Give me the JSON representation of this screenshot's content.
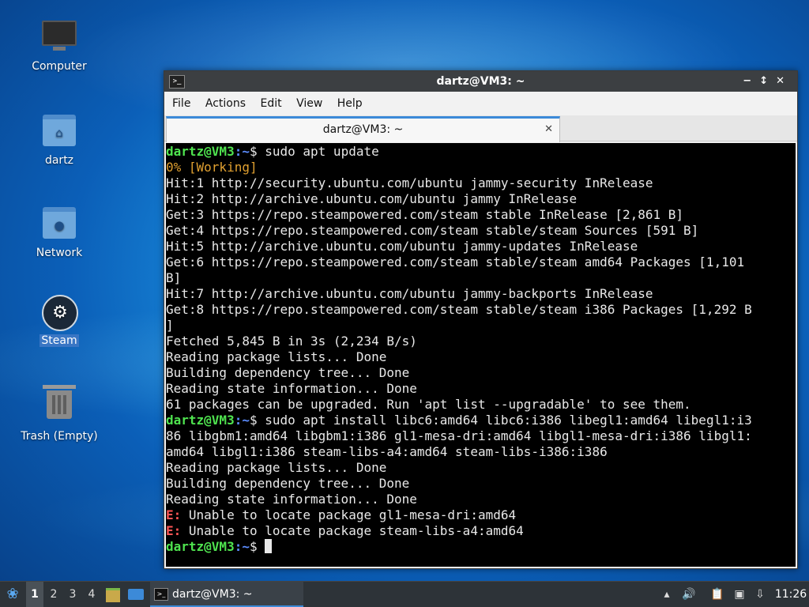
{
  "desktop": {
    "icons": [
      {
        "label": "Computer",
        "icon": "computer-icon"
      },
      {
        "label": "dartz",
        "icon": "home-folder-icon"
      },
      {
        "label": "Network",
        "icon": "network-folder-icon"
      },
      {
        "label": "Steam",
        "icon": "steam-icon"
      },
      {
        "label": "Trash (Empty)",
        "icon": "trash-icon"
      }
    ]
  },
  "window": {
    "title": "dartz@VM3: ~",
    "controls": {
      "minimize": "−",
      "maximize": "↕",
      "close": "✕"
    },
    "menu": [
      "File",
      "Actions",
      "Edit",
      "View",
      "Help"
    ],
    "tab": {
      "label": "dartz@VM3: ~",
      "close": "✕"
    }
  },
  "terminal": {
    "prompt_user": "dartz@VM3",
    "prompt_path": ":~",
    "prompt_symbol": "$ ",
    "lines": [
      {
        "kind": "prompt",
        "text": "sudo apt update"
      },
      {
        "kind": "warn",
        "text": "0% [Working]"
      },
      {
        "kind": "out",
        "text": "Hit:1 http://security.ubuntu.com/ubuntu jammy-security InRelease"
      },
      {
        "kind": "out",
        "text": "Hit:2 http://archive.ubuntu.com/ubuntu jammy InRelease"
      },
      {
        "kind": "out",
        "text": "Get:3 https://repo.steampowered.com/steam stable InRelease [2,861 B]"
      },
      {
        "kind": "out",
        "text": "Get:4 https://repo.steampowered.com/steam stable/steam Sources [591 B]"
      },
      {
        "kind": "out",
        "text": "Hit:5 http://archive.ubuntu.com/ubuntu jammy-updates InRelease"
      },
      {
        "kind": "out",
        "text": "Get:6 https://repo.steampowered.com/steam stable/steam amd64 Packages [1,101"
      },
      {
        "kind": "out",
        "text": "B]"
      },
      {
        "kind": "out",
        "text": "Hit:7 http://archive.ubuntu.com/ubuntu jammy-backports InRelease"
      },
      {
        "kind": "out",
        "text": "Get:8 https://repo.steampowered.com/steam stable/steam i386 Packages [1,292 B"
      },
      {
        "kind": "out",
        "text": "]"
      },
      {
        "kind": "out",
        "text": "Fetched 5,845 B in 3s (2,234 B/s)"
      },
      {
        "kind": "out",
        "text": "Reading package lists... Done"
      },
      {
        "kind": "out",
        "text": "Building dependency tree... Done"
      },
      {
        "kind": "out",
        "text": "Reading state information... Done"
      },
      {
        "kind": "out",
        "text": "61 packages can be upgraded. Run 'apt list --upgradable' to see them."
      },
      {
        "kind": "prompt",
        "text": "sudo apt install libc6:amd64 libc6:i386 libegl1:amd64 libegl1:i3"
      },
      {
        "kind": "out",
        "text": "86 libgbm1:amd64 libgbm1:i386 gl1-mesa-dri:amd64 libgl1-mesa-dri:i386 libgl1:"
      },
      {
        "kind": "out",
        "text": "amd64 libgl1:i386 steam-libs-a4:amd64 steam-libs-i386:i386"
      },
      {
        "kind": "out",
        "text": "Reading package lists... Done"
      },
      {
        "kind": "out",
        "text": "Building dependency tree... Done"
      },
      {
        "kind": "out",
        "text": "Reading state information... Done"
      },
      {
        "kind": "error",
        "prefix": "E:",
        "text": " Unable to locate package gl1-mesa-dri:amd64"
      },
      {
        "kind": "error",
        "prefix": "E:",
        "text": " Unable to locate package steam-libs-a4:amd64"
      },
      {
        "kind": "prompt",
        "text": "",
        "cursor": true
      }
    ]
  },
  "taskbar": {
    "menu_icon": "start-menu-icon",
    "workspaces": [
      "1",
      "2",
      "3",
      "4"
    ],
    "active_workspace": "1",
    "task_label": "dartz@VM3: ~",
    "clock": "11:26",
    "colors": {
      "accent": "#3c8ad8",
      "panel": "#2d3338"
    }
  }
}
